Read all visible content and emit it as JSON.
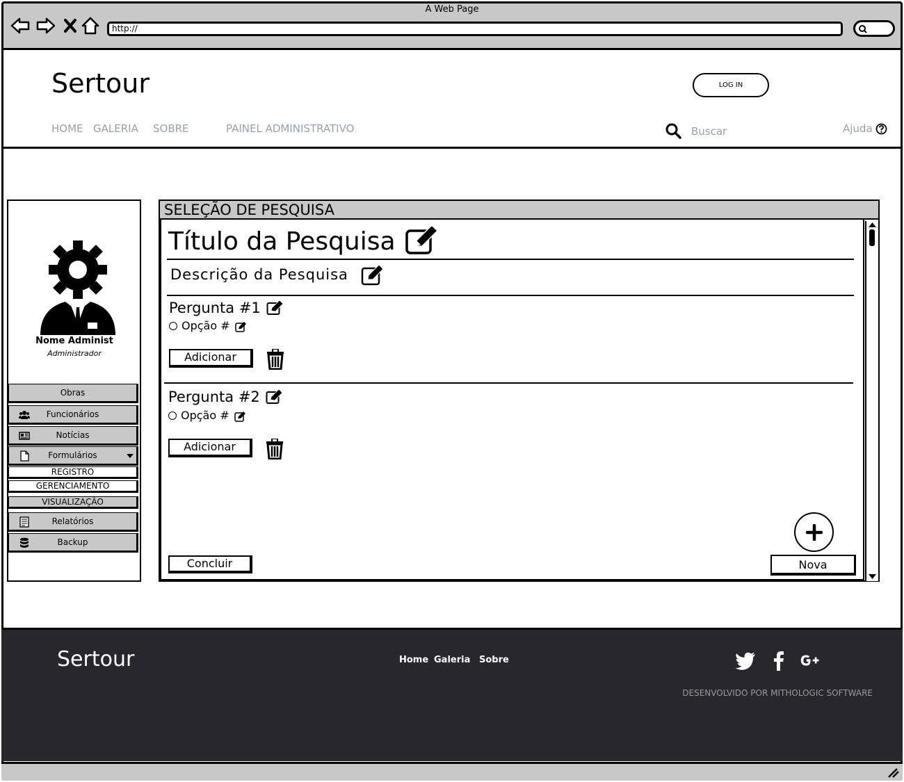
{
  "browser": {
    "window_title": "A Web Page",
    "url": "http://"
  },
  "header": {
    "logo": "Sertour",
    "login_label": "LOG IN",
    "nav": [
      "HOME",
      "GALERIA",
      "SOBRE",
      "PAINEL ADMINISTRATIVO"
    ],
    "search_placeholder": "Buscar",
    "help_label": "Ajuda"
  },
  "sidebar": {
    "user_name": "Nome Administ",
    "user_role": "Administrador",
    "menu": [
      {
        "label": "Obras",
        "icon": "none"
      },
      {
        "label": "Funcionários",
        "icon": "users-icon"
      },
      {
        "label": "Notícias",
        "icon": "newspaper-icon"
      },
      {
        "label": "Formulários",
        "icon": "file-icon"
      },
      {
        "label": "Relatórios",
        "icon": "report-icon"
      },
      {
        "label": "Backup",
        "icon": "database-icon"
      }
    ],
    "submenu": [
      "REGISTRO",
      "GERENCIAMENTO",
      "VISUALIZAÇÃO"
    ]
  },
  "panel": {
    "title": "SELEÇÃO DE PESQUISA",
    "survey_title": "Título da Pesquisa",
    "survey_description": "Descrição da Pesquisa",
    "questions": [
      {
        "title": "Pergunta #1",
        "option": "Opção #",
        "add_label": "Adicionar"
      },
      {
        "title": "Pergunta #2",
        "option": "Opção #",
        "add_label": "Adicionar"
      }
    ],
    "fab_symbol": "+",
    "new_label": "Nova",
    "finish_label": "Concluir"
  },
  "footer": {
    "logo": "Sertour",
    "links": [
      "Home",
      "Galeria",
      "Sobre"
    ],
    "social": [
      "twitter-icon",
      "facebook-icon",
      "google-plus-icon"
    ],
    "credit": "DESENVOLVIDO POR MITHOLOGIC SOFTWARE"
  },
  "colors": {
    "chrome_gray": "#c8c8c8",
    "nav_gray": "#9aa0a6",
    "footer_bg": "#28282c"
  }
}
